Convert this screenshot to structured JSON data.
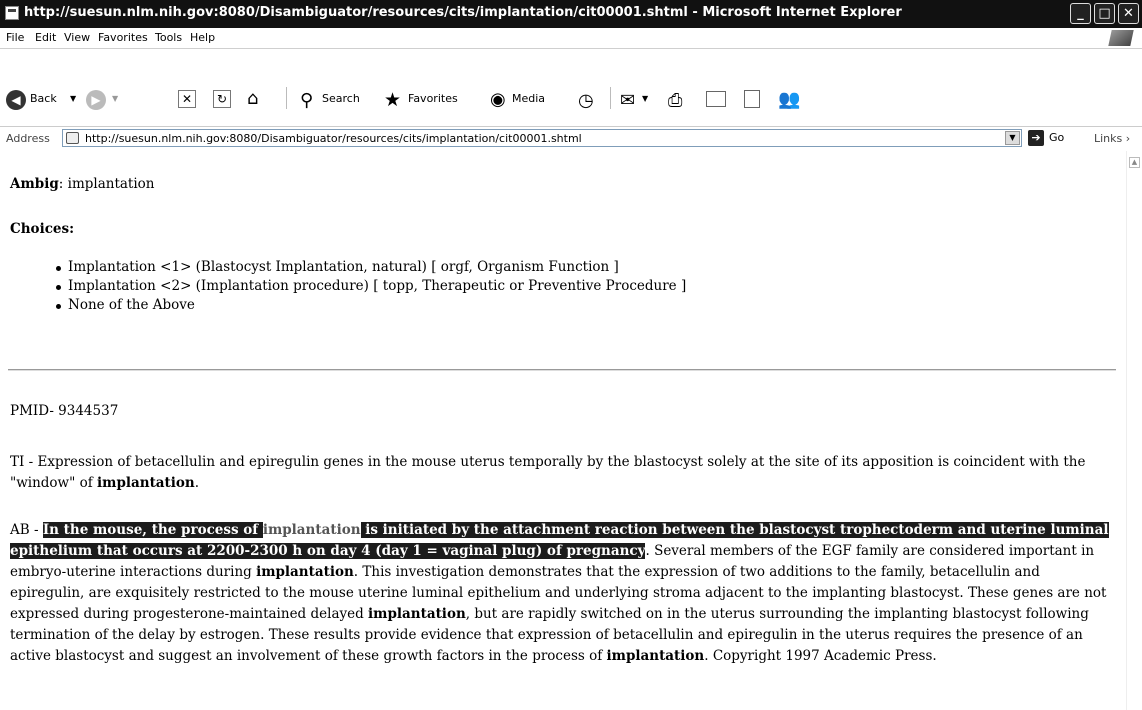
{
  "window": {
    "title": "http://suesun.nlm.nih.gov:8080/Disambiguator/resources/cits/implantation/cit00001.shtml - Microsoft Internet Explorer"
  },
  "menu": [
    "File",
    "Edit",
    "View",
    "Favorites",
    "Tools",
    "Help"
  ],
  "toolbar": {
    "back": "Back",
    "search": "Search",
    "favorites": "Favorites",
    "media": "Media"
  },
  "address": {
    "label": "Address",
    "url": "http://suesun.nlm.nih.gov:8080/Disambiguator/resources/cits/implantation/cit00001.shtml",
    "go": "Go",
    "links": "Links"
  },
  "content": {
    "ambig_label": "Ambig",
    "ambig_value": ": implantation",
    "choices_label": "Choices:",
    "choices": [
      "Implantation <1> (Blastocyst Implantation, natural) [ orgf, Organism Function ]",
      "Implantation <2> (Implantation procedure) [ topp, Therapeutic or Preventive Procedure ]",
      "None of the Above"
    ],
    "pmid": "PMID- 9344537",
    "ti": {
      "prefix": "TI - Expression of betacellulin and epiregulin genes in the mouse uterus temporally by the blastocyst solely at the site of its apposition is coincident with the \"window\" of ",
      "term": "implantation",
      "suffix": "."
    },
    "ab": {
      "prefix": "AB - ",
      "hl_1": "In the mouse, the process of ",
      "hl_term": "implantation",
      "hl_2": " is initiated by the attachment reaction between the blastocyst trophectoderm and uterine luminal epithelium that occurs at 2200-2300 h on day 4 (day 1 = vaginal plug) of pregnancy",
      "t1": ". Several members of the EGF family are considered important in embryo-uterine interactions during ",
      "term1": "implantation",
      "t2": ". This investigation demonstrates that the expression of two additions to the family, betacellulin and epiregulin, are exquisitely restricted to the mouse uterine luminal epithelium and underlying stroma adjacent to the implanting blastocyst. These genes are not expressed during progesterone-maintained delayed ",
      "term2": "implantation",
      "t3": ", but are rapidly switched on in the uterus surrounding the implanting blastocyst following termination of the delay by estrogen. These results provide evidence that expression of betacellulin and epiregulin in the uterus requires the presence of an active blastocyst and suggest an involvement of these growth factors in the process of ",
      "term3": "implantation",
      "t4": ". Copyright 1997 Academic Press."
    }
  }
}
